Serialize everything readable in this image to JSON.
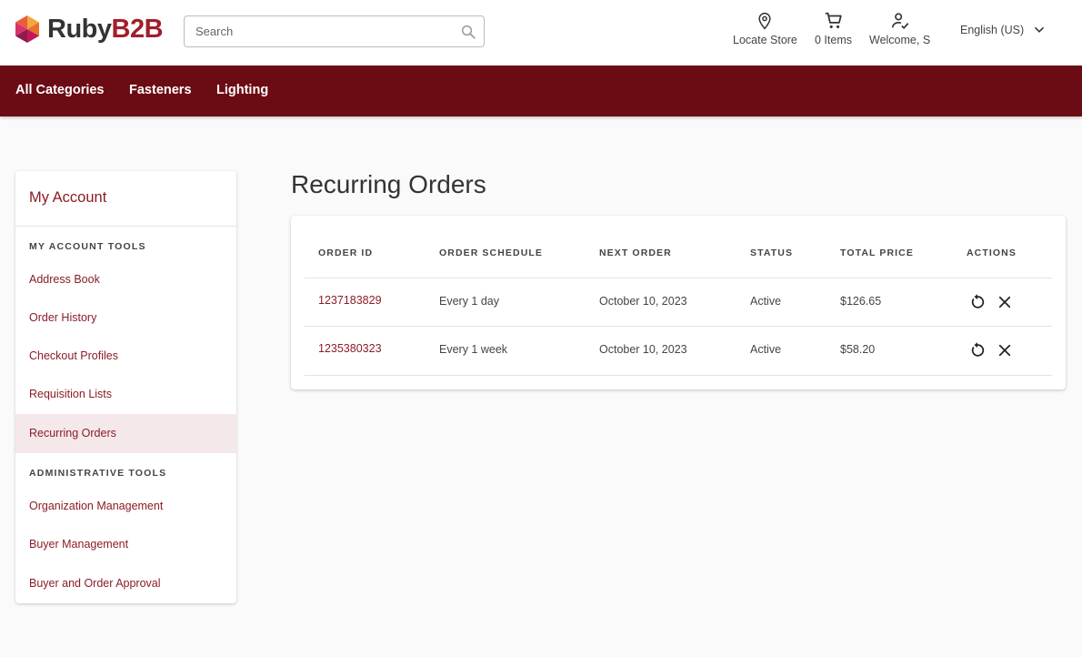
{
  "brand": {
    "name_part1": "Ruby",
    "name_part2": "B2B",
    "colors": {
      "primary": "#a31d2a",
      "nav_bg": "#6b0b14",
      "link": "#8b1c26"
    }
  },
  "search": {
    "placeholder": "Search",
    "value": "",
    "icon": "search-icon"
  },
  "header": {
    "locate_store": "Locate Store",
    "cart": "0 Items",
    "welcome": "Welcome, S",
    "language": "English (US)"
  },
  "nav": {
    "items": [
      "All Categories",
      "Fasteners",
      "Lighting"
    ]
  },
  "sidebar": {
    "title": "My Account",
    "sections": [
      {
        "title": "MY ACCOUNT TOOLS",
        "items": [
          "Address Book",
          "Order History",
          "Checkout Profiles",
          "Requisition Lists",
          "Recurring Orders"
        ]
      },
      {
        "title": "ADMINISTRATIVE TOOLS",
        "items": [
          "Organization Management",
          "Buyer Management",
          "Buyer and Order Approval"
        ]
      }
    ],
    "active_item": "Recurring Orders"
  },
  "page": {
    "title": "Recurring Orders"
  },
  "table": {
    "columns": [
      "ORDER ID",
      "ORDER SCHEDULE",
      "NEXT ORDER",
      "STATUS",
      "TOTAL PRICE",
      "ACTIONS"
    ],
    "rows": [
      {
        "order_id": "1237183829",
        "schedule": "Every 1 day",
        "next_order": "October 10, 2023",
        "status": "Active",
        "total": "$126.65",
        "actions": [
          "refresh-icon",
          "close-icon"
        ]
      },
      {
        "order_id": "1235380323",
        "schedule": "Every 1 week",
        "next_order": "October 10, 2023",
        "status": "Active",
        "total": "$58.20",
        "actions": [
          "refresh-icon",
          "close-icon"
        ]
      }
    ]
  }
}
